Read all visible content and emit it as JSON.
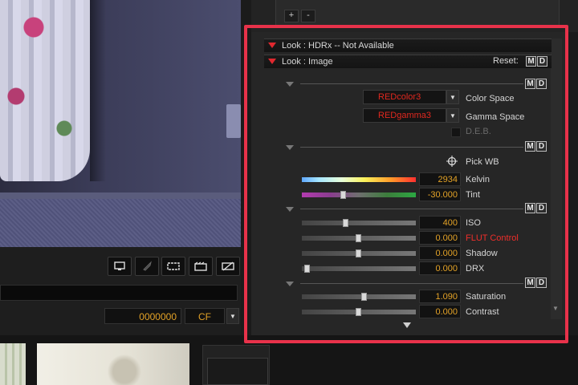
{
  "colors": {
    "accent_red": "#e0282f",
    "value_orange": "#e3a227",
    "highlight_frame": "#e8324a"
  },
  "preview": {
    "description_icon": "video-frame"
  },
  "toolbar": {
    "icons": [
      "monitor-icon",
      "rocket-icon",
      "window-frame-icon",
      "clapperboard-icon",
      "crossed-frame-icon"
    ]
  },
  "playback": {
    "timecode": "0000000",
    "cf_value": "CF"
  },
  "top_buttons": {
    "add_label": "+",
    "remove_label": "-"
  },
  "sections": {
    "hdrx": {
      "title": "Look : HDRx -- Not Available"
    },
    "image": {
      "title": "Look : Image",
      "reset_label": "Reset:"
    }
  },
  "md": {
    "m": "M",
    "d": "D"
  },
  "color": {
    "color_space_value": "REDcolor3",
    "color_space_label": "Color Space",
    "gamma_space_value": "REDgamma3",
    "gamma_space_label": "Gamma Space",
    "deb_label": "D.E.B."
  },
  "white_balance": {
    "pick_wb_label": "Pick WB",
    "kelvin_value": "2934",
    "kelvin_label": "Kelvin",
    "kelvin_level": 0.33,
    "tint_value": "-30.000",
    "tint_label": "Tint",
    "tint_level": 0.36
  },
  "exposure": {
    "iso_value": "400",
    "iso_label": "ISO",
    "iso_level": 0.38,
    "flut_value": "0.000",
    "flut_label": "FLUT Control",
    "flut_level": 0.5,
    "shadow_value": "0.000",
    "shadow_label": "Shadow",
    "shadow_level": 0.5,
    "drx_value": "0.000",
    "drx_label": "DRX",
    "drx_level": 0.02
  },
  "tone": {
    "saturation_value": "1.090",
    "saturation_label": "Saturation",
    "saturation_level": 0.55,
    "contrast_value": "0.000",
    "contrast_label": "Contrast",
    "contrast_level": 0.5
  }
}
